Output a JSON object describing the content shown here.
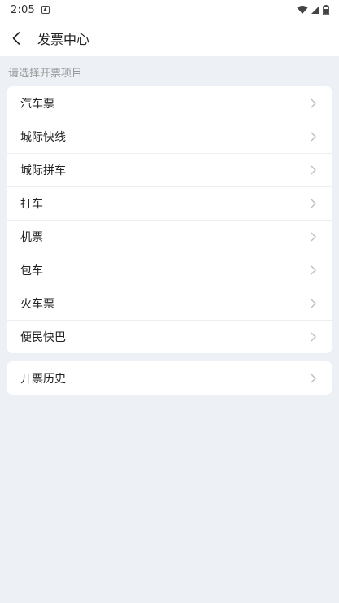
{
  "status_bar": {
    "time": "2:05",
    "icons": [
      "notification-icon",
      "wifi-icon",
      "signal-icon",
      "battery-icon"
    ]
  },
  "header": {
    "title": "发票中心",
    "back_icon": "chevron-left-icon"
  },
  "section_hint": "请选择开票项目",
  "invoice_items": [
    {
      "label": "汽车票"
    },
    {
      "label": "城际快线"
    },
    {
      "label": "城际拼车"
    },
    {
      "label": "打车"
    },
    {
      "label": "机票"
    },
    {
      "label": "包车"
    },
    {
      "label": "火车票"
    },
    {
      "label": "便民快巴"
    }
  ],
  "history": {
    "label": "开票历史"
  },
  "colors": {
    "background": "#edf0f5",
    "card": "#ffffff",
    "hint_text": "#999999",
    "chevron": "#bbbbbb"
  }
}
